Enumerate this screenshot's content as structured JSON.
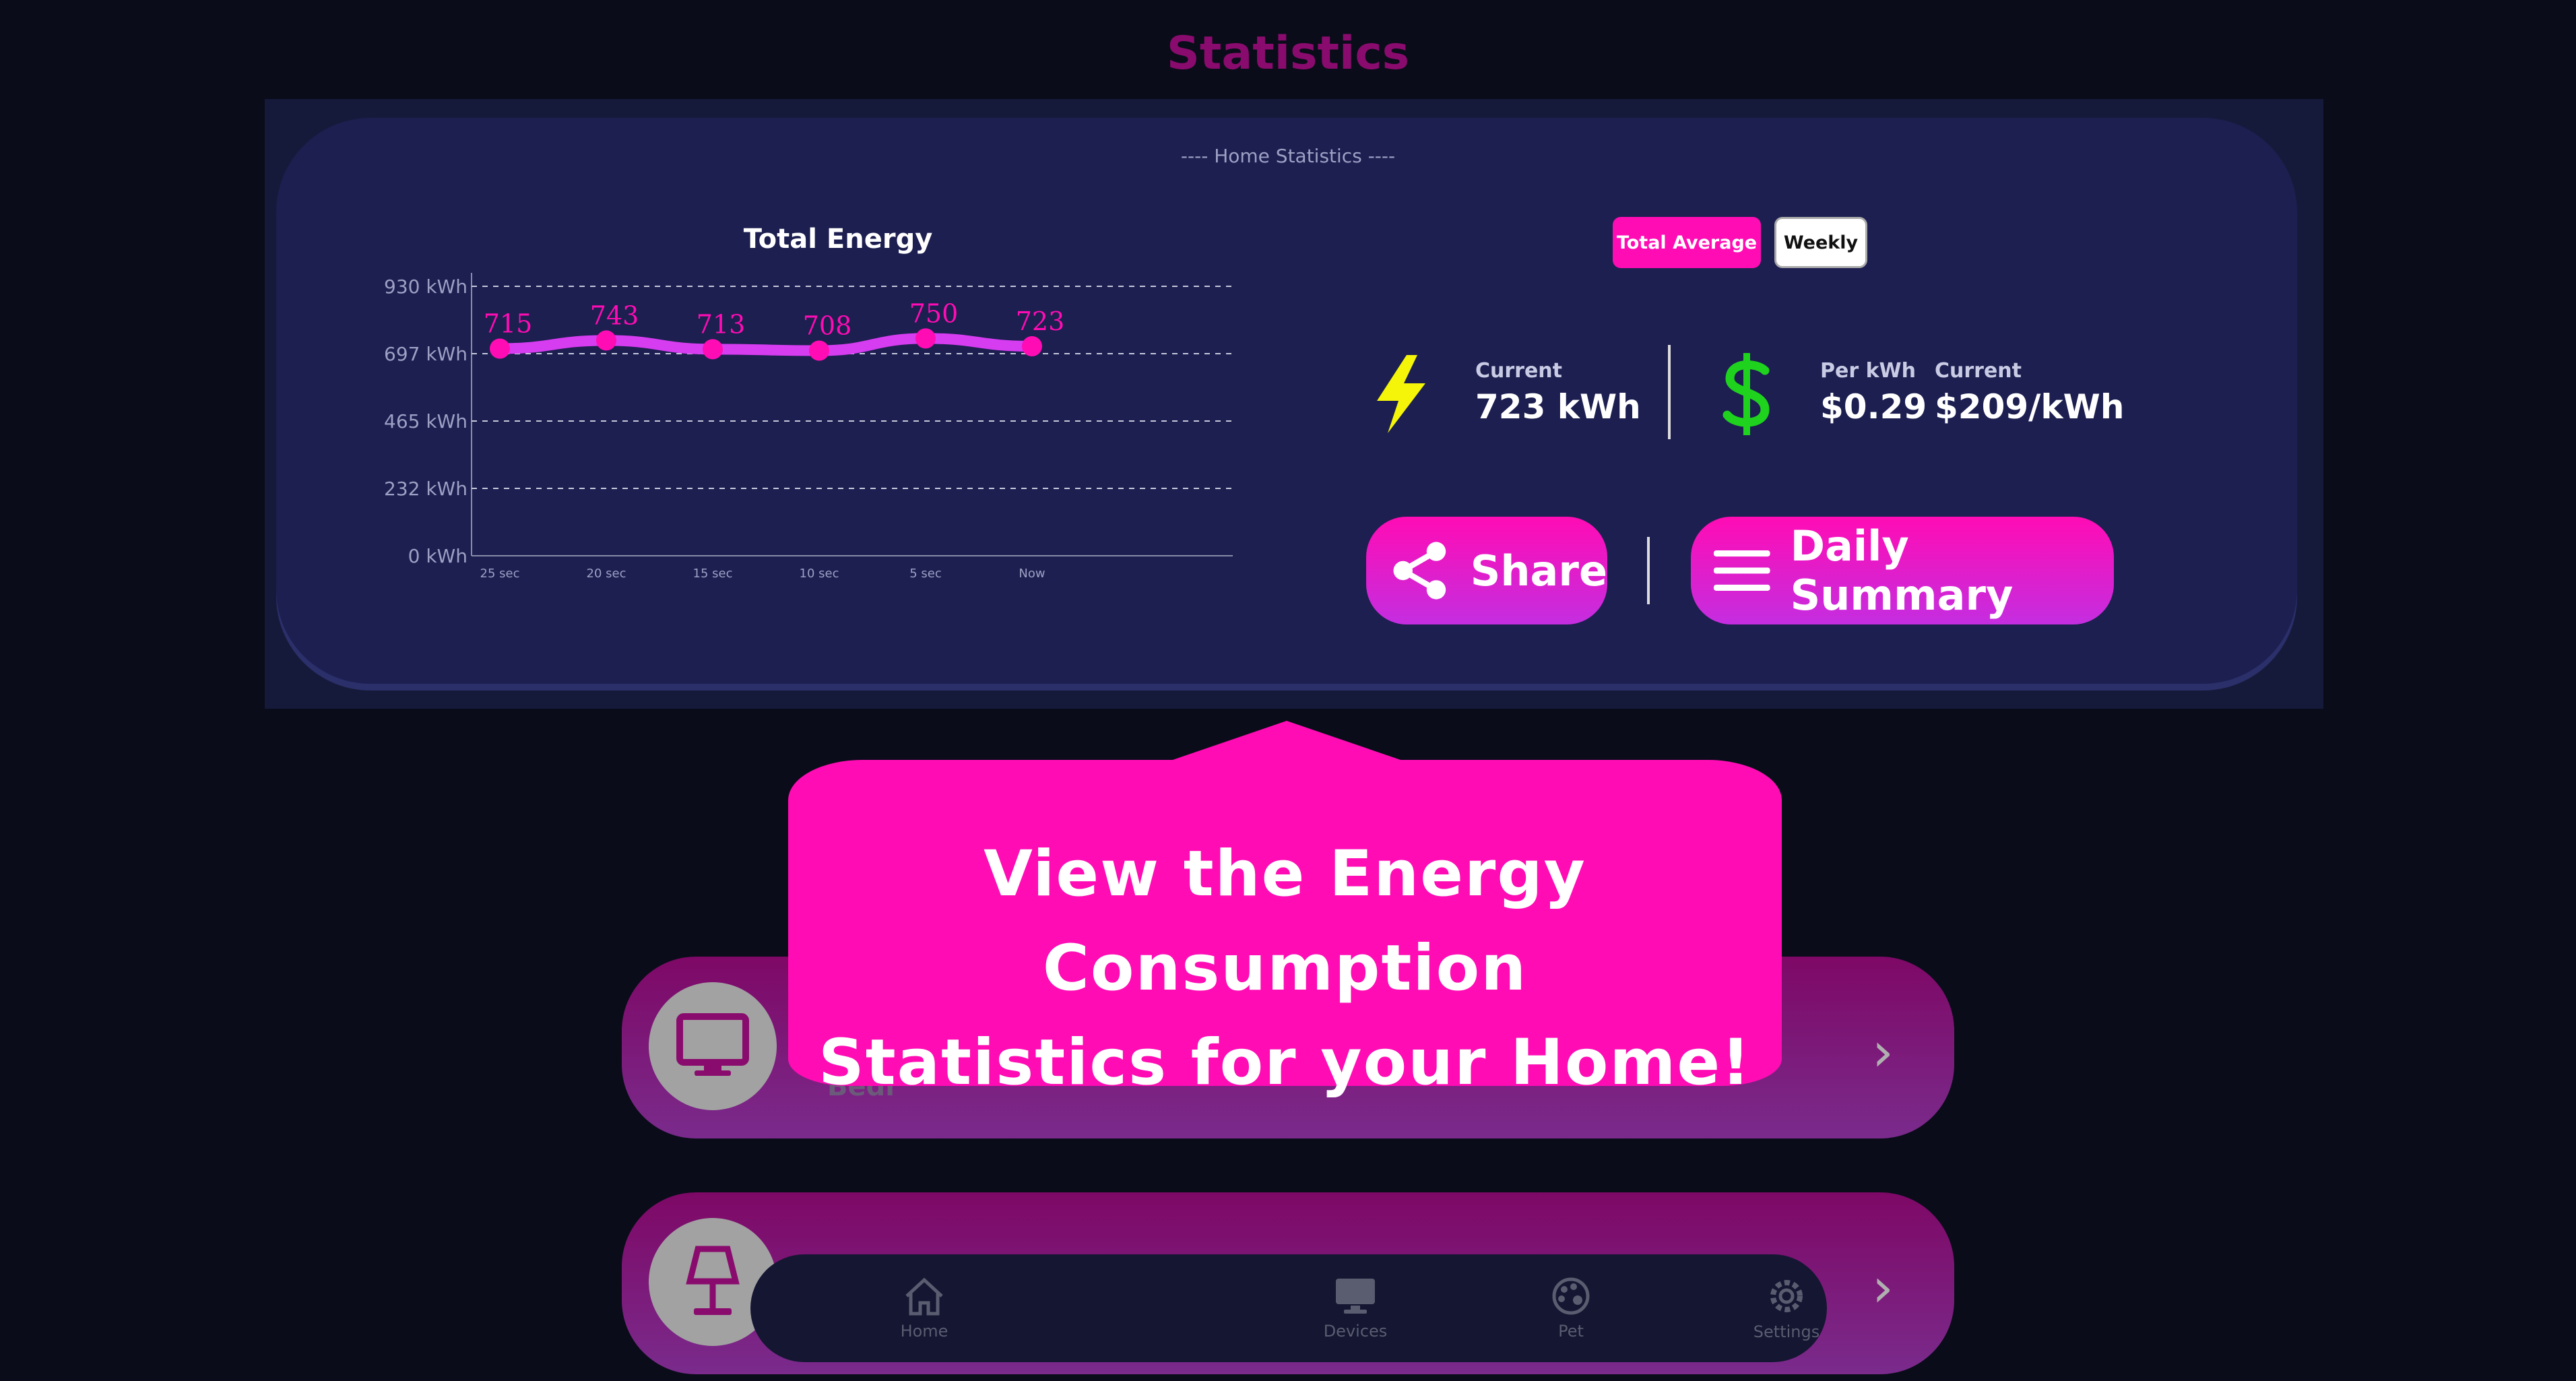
{
  "page_title": "Statistics",
  "panel": {
    "section_label": "---- Home Statistics ----",
    "toggles": {
      "total_average": "Total Average",
      "weekly": "Weekly"
    }
  },
  "energy": {
    "label": "Current",
    "value": "723 kWh"
  },
  "cost": {
    "per_kwh_label": "Per kWh",
    "per_kwh_value": "$0.29",
    "current_label": "Current",
    "current_value": "$209/kWh"
  },
  "buttons": {
    "share": "Share",
    "daily_summary": "Daily Summary"
  },
  "tooltip": {
    "line1": "View the Energy Consumption",
    "line2": "Statistics for your Home!"
  },
  "cards": [
    {
      "label": "Bedr"
    }
  ],
  "nav": {
    "home": "Home",
    "devices": "Devices",
    "pet": "Pet",
    "settings": "Settings"
  },
  "colors": {
    "accent": "#ff0cb4",
    "bolt": "#f5f50a",
    "dollar": "#1ed21e",
    "line": "#d63cf0"
  },
  "icons": [
    "bolt-icon",
    "dollar-icon",
    "share-icon",
    "menu-icon",
    "monitor-icon",
    "lamp-icon",
    "chevron-right-icon",
    "home-icon",
    "devices-icon",
    "pet-icon",
    "settings-icon"
  ],
  "chart_data": {
    "type": "line",
    "title": "Total Energy",
    "categories": [
      "25 sec",
      "20 sec",
      "15 sec",
      "10 sec",
      "5 sec",
      "Now"
    ],
    "values": [
      715,
      743,
      713,
      708,
      750,
      723
    ],
    "y_ticks": [
      "930 kWh",
      "697 kWh",
      "465 kWh",
      "232 kWh",
      "0 kWh"
    ],
    "ylim": [
      0,
      930
    ],
    "grid": true
  }
}
